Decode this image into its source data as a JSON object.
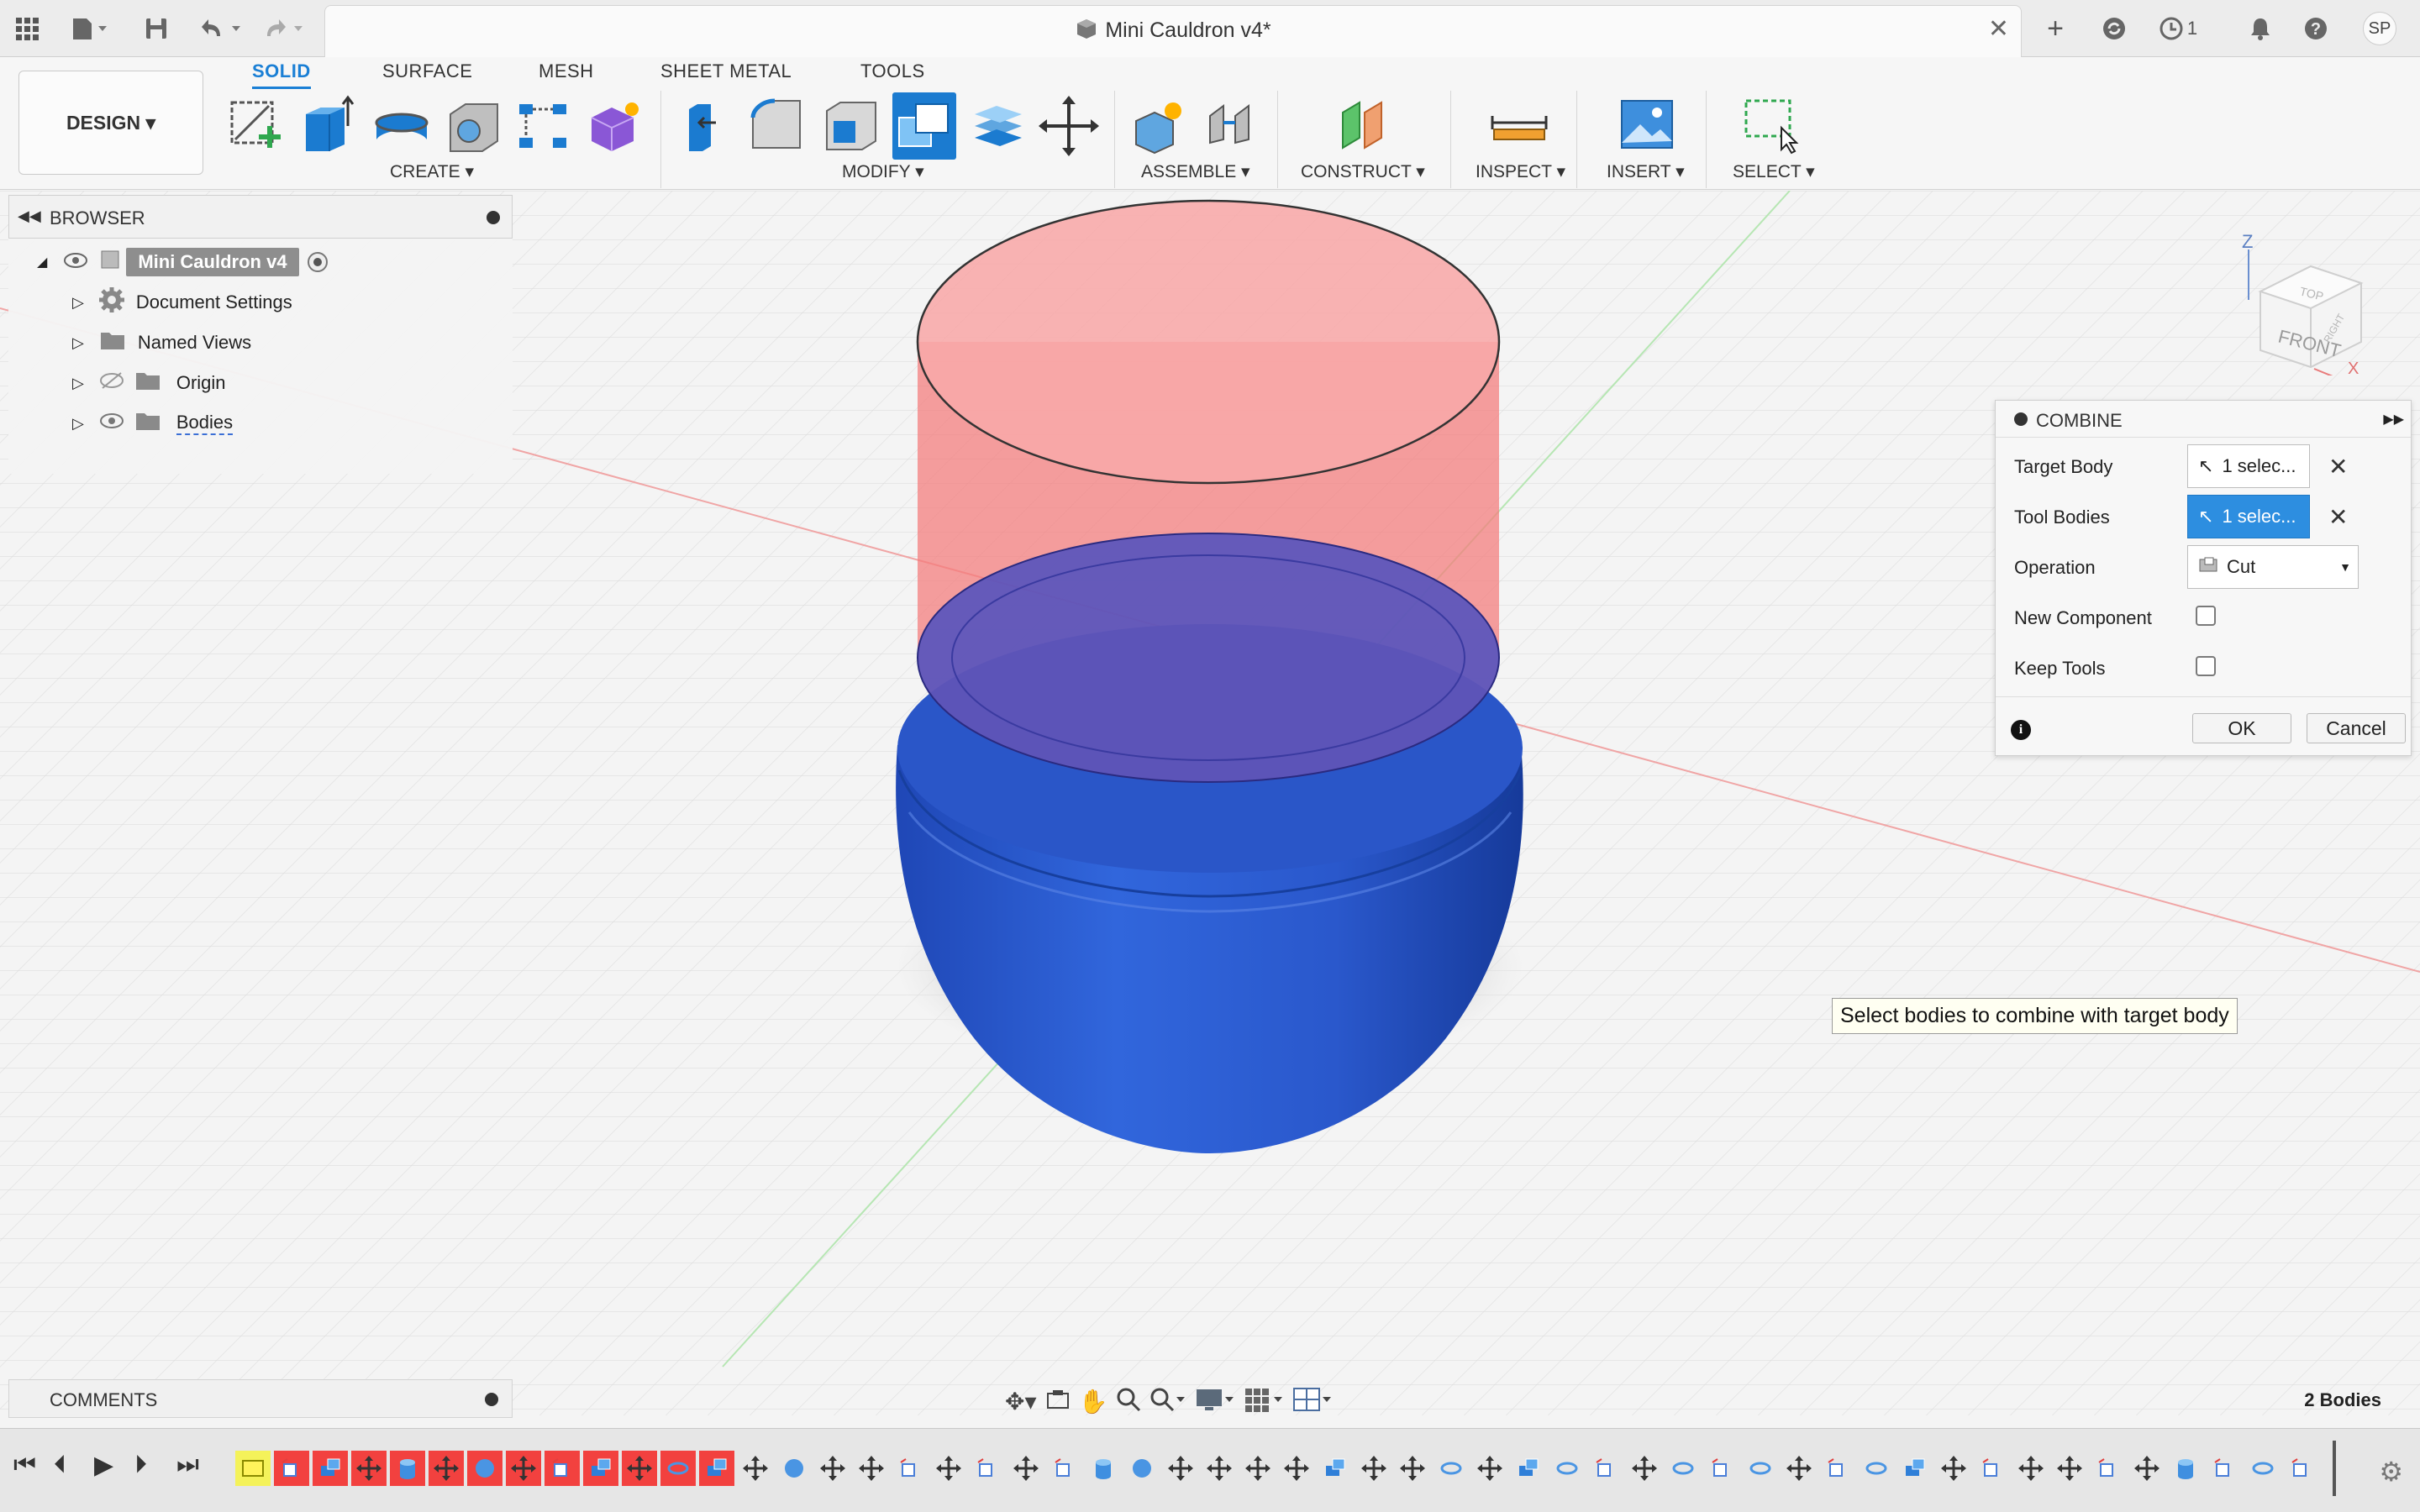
{
  "window": {
    "title": "Mini Cauldron v4*"
  },
  "topbar": {
    "notification_count": "1",
    "user_initials": "SP"
  },
  "workspace": {
    "mode_label": "DESIGN ▾"
  },
  "tabs": [
    "SOLID",
    "SURFACE",
    "MESH",
    "SHEET METAL",
    "TOOLS"
  ],
  "tool_groups": [
    "CREATE ▾",
    "MODIFY ▾",
    "ASSEMBLE ▾",
    "CONSTRUCT ▾",
    "INSPECT ▾",
    "INSERT ▾",
    "SELECT ▾"
  ],
  "browser": {
    "header": "BROWSER",
    "root": "Mini Cauldron v4",
    "items": [
      "Document Settings",
      "Named Views",
      "Origin",
      "Bodies"
    ]
  },
  "viewcube": {
    "front_label": "FRONT",
    "top_label": "TOP",
    "right_label": "RIGHT",
    "axis_z": "Z",
    "axis_x": "X"
  },
  "combine": {
    "title": "COMBINE",
    "target_body_label": "Target Body",
    "target_body_value": "1 selec...",
    "tool_bodies_label": "Tool Bodies",
    "tool_bodies_value": "1 selec...",
    "operation_label": "Operation",
    "operation_value": "Cut",
    "new_component_label": "New Component",
    "keep_tools_label": "Keep Tools",
    "ok_label": "OK",
    "cancel_label": "Cancel"
  },
  "tooltip": "Select bodies to combine with target body",
  "comments": {
    "label": "COMMENTS"
  },
  "status": {
    "bodies_count": "2 Bodies"
  },
  "colors": {
    "accent": "#1a7fd5",
    "tool_body": "#f26a6a",
    "target_body": "#2b5fd0",
    "highlight": "#f2413f"
  },
  "timeline": {
    "items": [
      "sketch",
      "plane",
      "extrude",
      "move",
      "cylinder",
      "move",
      "sphere",
      "move",
      "plane",
      "extrude",
      "move",
      "ellipse",
      "extrude",
      "move",
      "sphere",
      "move",
      "move",
      "plane",
      "move",
      "plane",
      "move",
      "plane",
      "cylinder",
      "sphere",
      "move",
      "move",
      "move",
      "move",
      "extrude",
      "move",
      "move",
      "ellipse",
      "move",
      "extrude",
      "ellipse",
      "plane",
      "move",
      "ellipse",
      "plane",
      "ellipse",
      "move",
      "plane",
      "ellipse",
      "extrude",
      "move",
      "plane",
      "move",
      "move",
      "plane",
      "move",
      "cylinder",
      "plane",
      "ellipse",
      "plane"
    ],
    "highlighted": [
      0,
      1,
      2,
      3,
      4,
      5,
      6,
      7,
      8,
      9,
      10,
      11,
      12
    ]
  }
}
